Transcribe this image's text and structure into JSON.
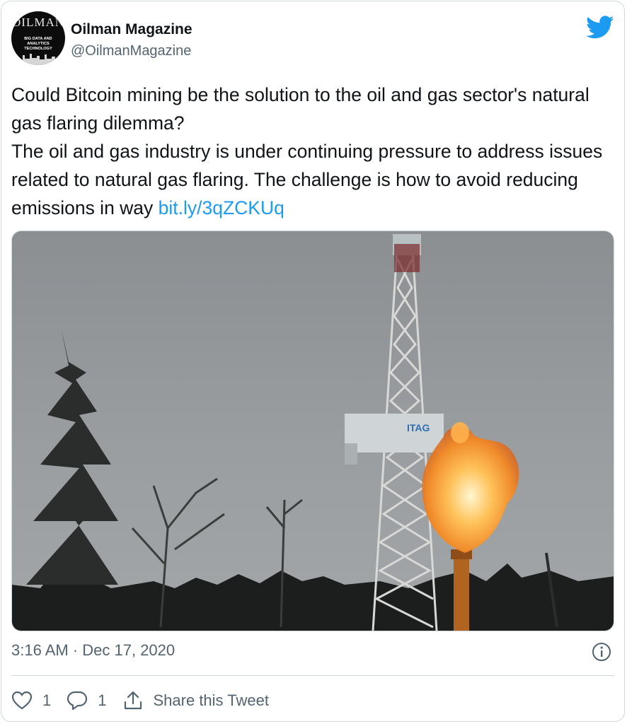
{
  "author": {
    "name": "Oilman Magazine",
    "handle": "@OilmanMagazine",
    "avatar_title": "OILMAN",
    "avatar_subtitle": "BIG DATA AND ANALYTICS TECHNOLOGY"
  },
  "tweet": {
    "line1": "Could Bitcoin mining be the solution to the oil and gas sector's natural gas flaring dilemma?",
    "line2": "The oil and gas industry is under continuing pressure to address issues related to natural gas flaring. The challenge is how to avoid reducing emissions in way ",
    "link": "bit.ly/3qZCKUq"
  },
  "photo": {
    "rig_sign": "ITAG"
  },
  "timestamp": "3:16 AM · Dec 17, 2020",
  "actions": {
    "likes": "1",
    "replies": "1",
    "share_label": "Share this Tweet"
  },
  "colors": {
    "link": "#1d9bf0",
    "bird": "#1d9bf0",
    "secondary": "#536471"
  }
}
